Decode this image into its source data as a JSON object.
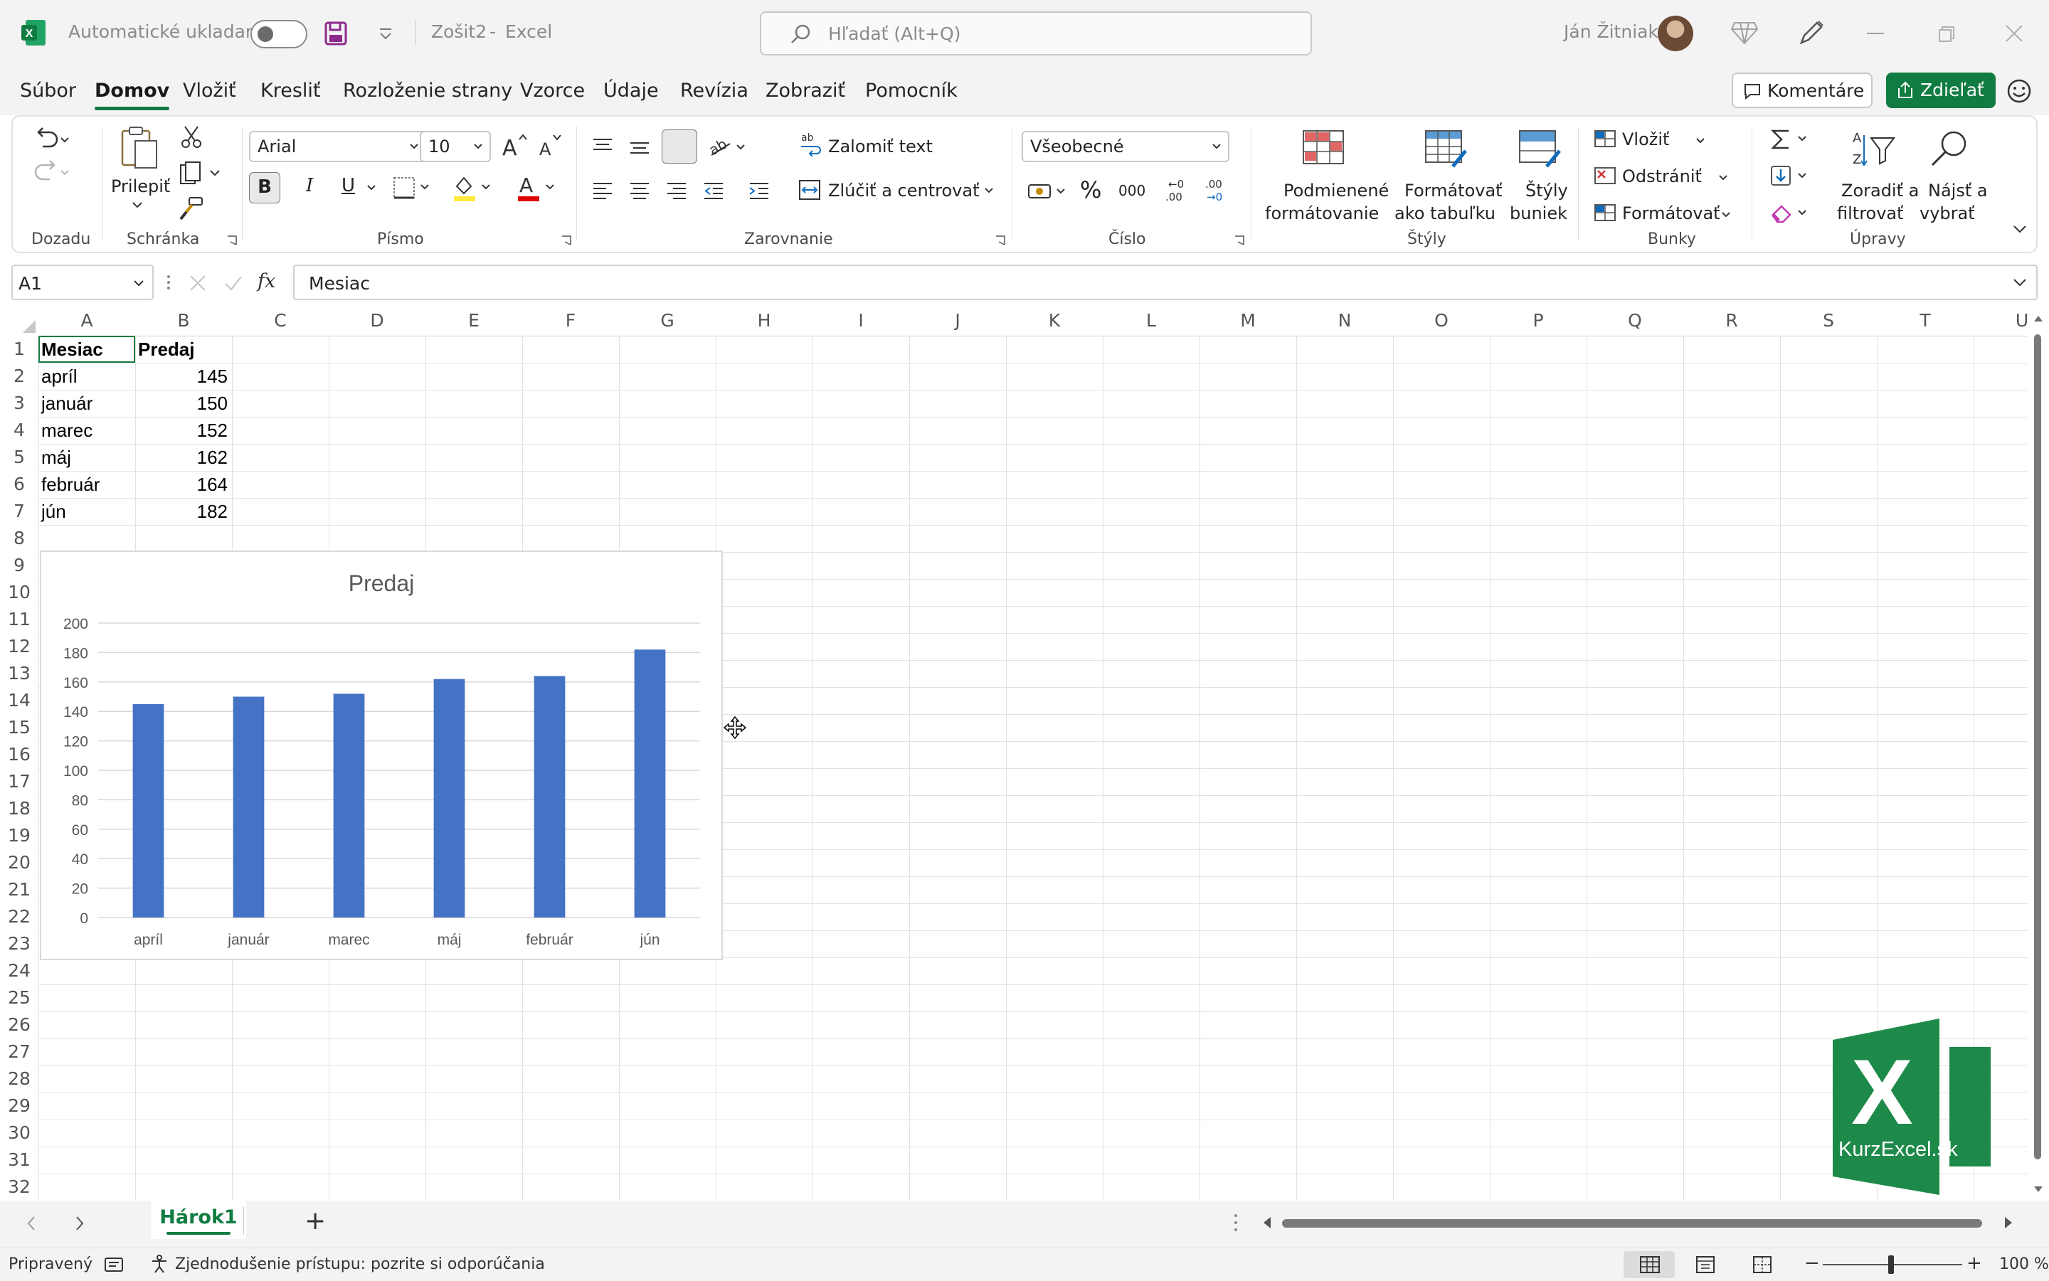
{
  "titlebar": {
    "autosave_label": "Automatické ukladanie",
    "doc_title": "Zošit2",
    "separator": "-",
    "app_name": "Excel",
    "search_placeholder": "Hľadať (Alt+Q)",
    "user_name": "Ján Žitniak"
  },
  "menu": {
    "items": [
      "Súbor",
      "Domov",
      "Vložiť",
      "Kresliť",
      "Rozloženie strany",
      "Vzorce",
      "Údaje",
      "Revízia",
      "Zobraziť",
      "Pomocník"
    ],
    "active": "Domov",
    "comments_label": "Komentáre",
    "share_label": "Zdieľať"
  },
  "ribbon": {
    "groups": {
      "undo": "Dozadu",
      "clipboard": "Schránka",
      "font": "Písmo",
      "alignment": "Zarovnanie",
      "number": "Číslo",
      "styles": "Štýly",
      "cells": "Bunky",
      "editing": "Úpravy"
    },
    "paste_label": "Prilepiť",
    "font_name": "Arial",
    "font_size": "10",
    "bold": "B",
    "italic": "I",
    "underline": "U",
    "wrap_text": "Zalomiť text",
    "merge_center": "Zlúčiť a centrovať",
    "number_format": "Všeobecné",
    "percent": "%",
    "thousands": "000",
    "cond_format": [
      "Podmienené",
      "formátovanie"
    ],
    "format_table": [
      "Formátovať",
      "ako tabuľku"
    ],
    "cell_styles": [
      "Štýly",
      "buniek"
    ],
    "insert": "Vložiť",
    "delete": "Odstrániť",
    "format": "Formátovať",
    "sort_filter": [
      "Zoradiť a",
      "filtrovať"
    ],
    "find_select": [
      "Nájsť a",
      "vybrať"
    ],
    "accent_color": "#107c41"
  },
  "formula_bar": {
    "name_box": "A1",
    "fx": "fx",
    "content": "Mesiac"
  },
  "grid": {
    "columns": [
      "A",
      "B",
      "C",
      "D",
      "E",
      "F",
      "G",
      "H",
      "I",
      "J",
      "K",
      "L",
      "M",
      "N",
      "O",
      "P",
      "Q",
      "R",
      "S",
      "T",
      "U"
    ],
    "rows": [
      "1",
      "2",
      "3",
      "4",
      "5",
      "6",
      "7",
      "8",
      "9",
      "10",
      "11",
      "12",
      "13",
      "14",
      "15",
      "16",
      "17",
      "18",
      "19",
      "20",
      "21",
      "22",
      "23",
      "24",
      "25",
      "26",
      "27",
      "28",
      "29",
      "30",
      "31",
      "32"
    ],
    "table": [
      [
        "Mesiac",
        "Predaj"
      ],
      [
        "apríl",
        "145"
      ],
      [
        "január",
        "150"
      ],
      [
        "marec",
        "152"
      ],
      [
        "máj",
        "162"
      ],
      [
        "február",
        "164"
      ],
      [
        "jún",
        "182"
      ]
    ]
  },
  "chart_data": {
    "type": "bar",
    "title": "Predaj",
    "categories": [
      "apríl",
      "január",
      "marec",
      "máj",
      "február",
      "jún"
    ],
    "values": [
      145,
      150,
      152,
      162,
      164,
      182
    ],
    "y_ticks": [
      "0",
      "20",
      "40",
      "60",
      "80",
      "100",
      "120",
      "140",
      "160",
      "180",
      "200"
    ],
    "ylim": [
      0,
      200
    ],
    "grid": true,
    "legend": "none",
    "bar_color": "#4472c4"
  },
  "logo": {
    "text": "KurzExcel.sk",
    "letter": "X"
  },
  "sheets": {
    "tabs": [
      "Hárok1"
    ],
    "active": "Hárok1",
    "add": "+"
  },
  "status": {
    "ready": "Pripravený",
    "accessibility": "Zjednodušenie prístupu: pozrite si odporúčania",
    "zoom": "100 %"
  }
}
